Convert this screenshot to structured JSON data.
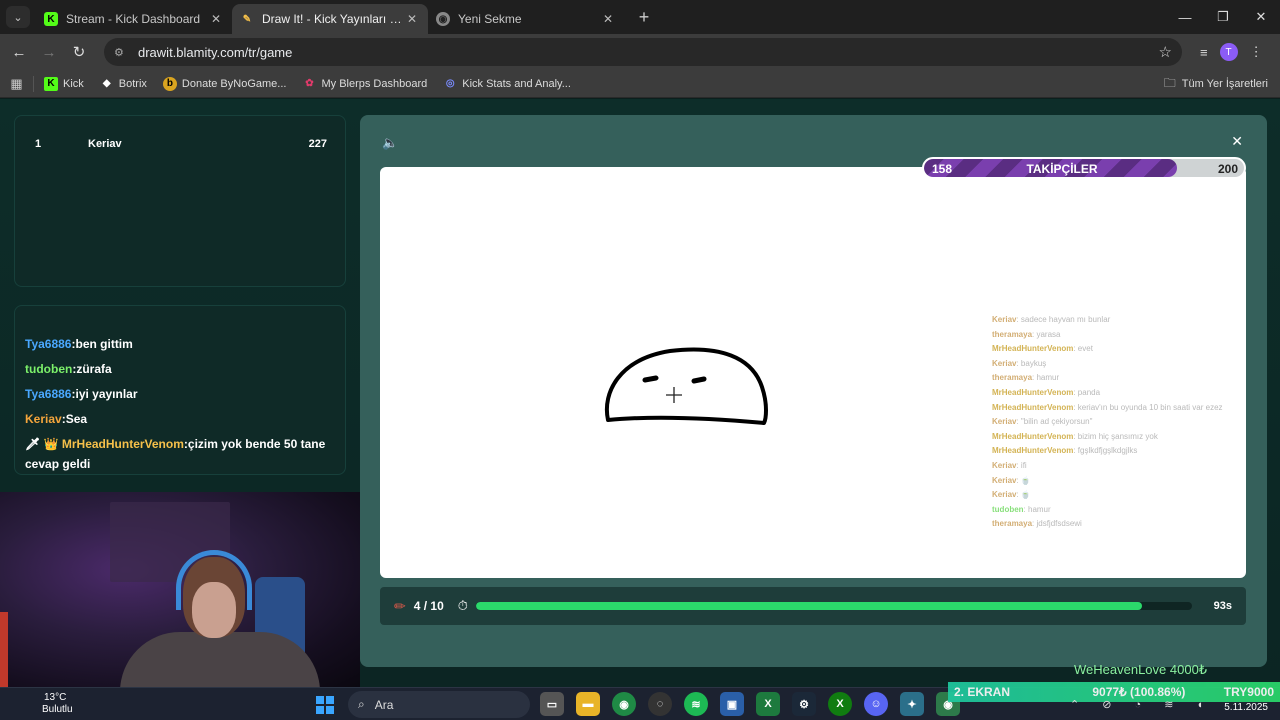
{
  "browser": {
    "tabs": [
      {
        "title": "Stream - Kick Dashboard",
        "icon": "kick-icon"
      },
      {
        "title": "Draw It! - Kick Yayınları İçin Çizim",
        "icon": "drawit-icon"
      },
      {
        "title": "Yeni Sekme",
        "icon": "chrome-icon"
      }
    ],
    "url": "drawit.blamity.com/tr/game",
    "profile_initial": "T",
    "bookmarks": [
      {
        "label": "Kick",
        "icon": "kick-icon"
      },
      {
        "label": "Botrix",
        "icon": "botrix-icon"
      },
      {
        "label": "Donate ByNoGame...",
        "icon": "bynogame-icon"
      },
      {
        "label": "My Blerps Dashboard",
        "icon": "blerp-icon"
      },
      {
        "label": "Kick Stats and Analy...",
        "icon": "stats-icon"
      }
    ],
    "all_bookmarks": "Tüm Yer İşaretleri"
  },
  "leaderboard": [
    {
      "rank": "1",
      "name": "Keriav",
      "score": "227"
    }
  ],
  "chat": [
    {
      "user": "Tya6886",
      "sep": ":",
      "msg": "ben gittim",
      "color": "#4aa8ff"
    },
    {
      "user": "tudoben",
      "sep": ":",
      "msg": "zürafa",
      "color": "#7cf06a"
    },
    {
      "user": "Tya6886",
      "sep": ":",
      "msg": "iyi yayınlar",
      "color": "#4aa8ff"
    },
    {
      "user": "Keriav",
      "sep": ":",
      "msg": "Sea",
      "color": "#f4a53c"
    },
    {
      "user": "MrHeadHunterVenom",
      "sep": ":",
      "msg": "çizim yok bende 50 tane cevap geldi",
      "color": "#f5c04a",
      "badges": "🗡 👑"
    }
  ],
  "follow_goal": {
    "current": "158",
    "label": "TAKİPÇİLER",
    "target": "200",
    "progress": 0.79
  },
  "overlay_chat": [
    {
      "user": "Keriav",
      "msg": ": sadece hayvan mı bunlar"
    },
    {
      "user": "theramaya",
      "msg": ": yarasa"
    },
    {
      "user": "MrHeadHunterVenom",
      "msg": ": evet"
    },
    {
      "user": "Keriav",
      "msg": ": baykuş"
    },
    {
      "user": "theramaya",
      "msg": ": hamur"
    },
    {
      "user": "MrHeadHunterVenom",
      "msg": ": panda"
    },
    {
      "user": "MrHeadHunterVenom",
      "msg": ": keriav'ın bu oyunda 10 bin saati var ezez"
    },
    {
      "user": "Keriav",
      "msg": ": \"bilin ad çekiyorsun\""
    },
    {
      "user": "MrHeadHunterVenom",
      "msg": ": bizim hiç şansımız yok"
    },
    {
      "user": "MrHeadHunterVenom",
      "msg": ": fgşlkdfjgşlkdgjlks"
    },
    {
      "user": "Keriav",
      "msg": ": ifi"
    },
    {
      "user": "Keriav",
      "msg": ": 🍵"
    },
    {
      "user": "Keriav",
      "msg": ": 🍵"
    },
    {
      "user": "tudoben",
      "msg": ": hamur"
    },
    {
      "user": "theramaya",
      "msg": ": jdsfjdfsdsewi"
    }
  ],
  "round": {
    "current": "4 / 10",
    "time_left": "93s",
    "time_progress": 0.93
  },
  "taskbar": {
    "weather_temp": "13°C",
    "weather_desc": "Bulutlu",
    "search_placeholder": "Ara",
    "ticker_label": "2. EKRAN",
    "ticker_amount": "9077₺ (100.86%)",
    "ticker_target": "TRY9000",
    "donation_text": "WeHeavenLove 4000₺",
    "date": "5.11.2025"
  }
}
